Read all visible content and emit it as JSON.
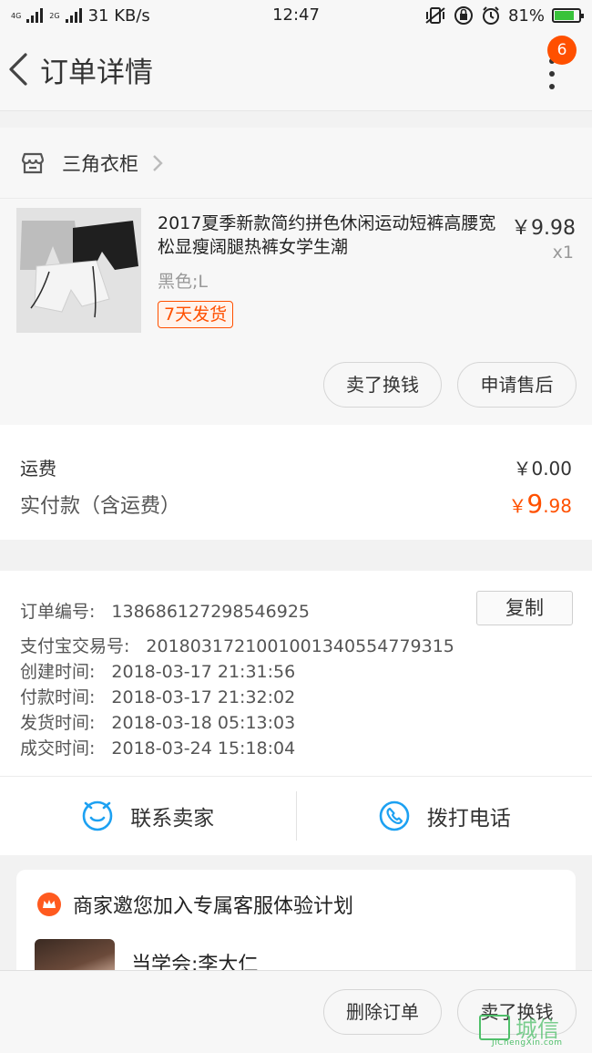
{
  "status_bar": {
    "net_types": [
      "4G",
      "2G"
    ],
    "speed": "31 KB/s",
    "time": "12:47",
    "battery": "81%",
    "battery_level": 0.81
  },
  "header": {
    "title": "订单详情",
    "badge_count": "6"
  },
  "shop": {
    "name": "三角衣柜"
  },
  "product": {
    "title": "2017夏季新款简约拼色休闲运动短裤高腰宽松显瘦阔腿热裤女学生潮",
    "price": "￥9.98",
    "quantity": "x1",
    "sku": "黑色;L",
    "ship_tag": "7天发货",
    "actions": {
      "sell": "卖了换钱",
      "after_sale": "申请售后"
    }
  },
  "fees": {
    "shipping_label": "运费",
    "shipping_value": "￥0.00",
    "paid_label": "实付款（含运费）",
    "paid_currency": "￥",
    "paid_int": "9",
    "paid_dec": ".98"
  },
  "order_info": {
    "order_no_label": "订单编号:",
    "order_no": "1386861272985469​25",
    "copy_label": "复制",
    "alipay_label": "支付宝交易号:",
    "alipay_no": "2018031721001001340554779315",
    "created_label": "创建时间:",
    "created": "2018-03-17 21:31:56",
    "paid_label": "付款时间:",
    "paid": "2018-03-17 21:32:02",
    "shipped_label": "发货时间:",
    "shipped": "2018-03-18 05:13:03",
    "done_label": "成交时间:",
    "done": "2018-03-24 15:18:04"
  },
  "contact": {
    "seller": "联系卖家",
    "call": "拨打电话"
  },
  "promo": {
    "title": "商家邀您加入专属客服体验计划",
    "sub": "当学会:李大仁"
  },
  "bottom": {
    "delete": "删除订单",
    "sell": "卖了换钱"
  },
  "watermark": {
    "main": "城信",
    "sub": "JiChengXin.com"
  },
  "colors": {
    "accent": "#ff5000",
    "icon_blue": "#1da1f2",
    "background": "#f2f2f2"
  }
}
